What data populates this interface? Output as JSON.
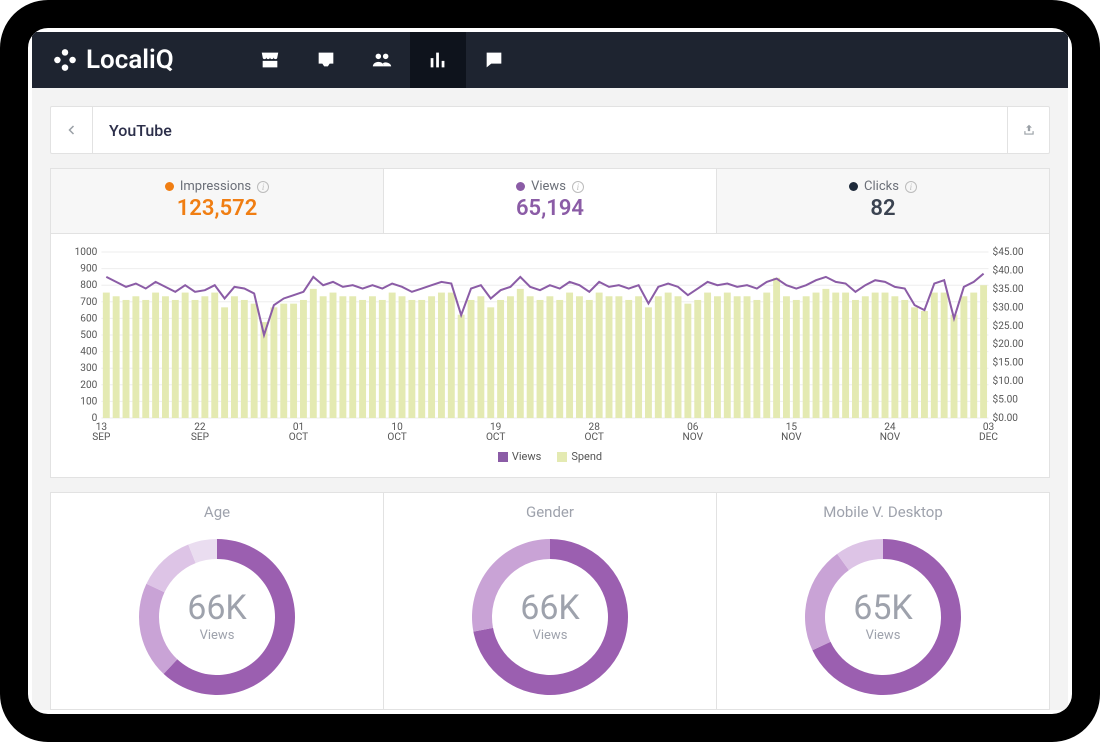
{
  "brand": {
    "name": "LocaliQ"
  },
  "nav": {
    "items": [
      "store",
      "inbox",
      "people",
      "analytics",
      "chat"
    ],
    "active": "analytics"
  },
  "page": {
    "title": "YouTube"
  },
  "metrics": [
    {
      "key": "impressions",
      "label": "Impressions",
      "value": "123,572",
      "color": "#f07e13",
      "valueColor": "#f07e13"
    },
    {
      "key": "views",
      "label": "Views",
      "value": "65,194",
      "color": "#8b5ca6",
      "valueColor": "#8b5ca6",
      "active": true
    },
    {
      "key": "clicks",
      "label": "Clicks",
      "value": "82",
      "color": "#1e2a3a",
      "valueColor": "#3b4351"
    }
  ],
  "chart_data": {
    "type": "bar+line",
    "title": "",
    "xlabel": "",
    "ylabel_left": "Views",
    "ylabel_right": "Spend",
    "ylim_left": [
      0,
      1000
    ],
    "ylim_right": [
      0,
      45
    ],
    "y_ticks_left": [
      0,
      100,
      200,
      300,
      400,
      500,
      600,
      700,
      800,
      900,
      1000
    ],
    "y_ticks_right": [
      "$0.00",
      "$5.00",
      "$10.00",
      "$15.00",
      "$20.00",
      "$25.00",
      "$30.00",
      "$35.00",
      "$40.00",
      "$45.00"
    ],
    "x_ticks": [
      "13 SEP",
      "22 SEP",
      "01 OCT",
      "10 OCT",
      "19 OCT",
      "28 OCT",
      "06 NOV",
      "15 NOV",
      "24 NOV",
      "03 DEC"
    ],
    "legend": [
      {
        "name": "Views",
        "color": "#8b5ca6"
      },
      {
        "name": "Spend",
        "color": "#e4eab2"
      }
    ],
    "series": [
      {
        "name": "Views",
        "type": "line",
        "color": "#8b5ca6",
        "values": [
          850,
          820,
          790,
          810,
          780,
          820,
          790,
          760,
          800,
          760,
          770,
          800,
          720,
          790,
          780,
          750,
          500,
          680,
          720,
          740,
          760,
          850,
          800,
          820,
          790,
          800,
          780,
          800,
          780,
          810,
          790,
          760,
          780,
          800,
          820,
          810,
          620,
          780,
          800,
          720,
          770,
          790,
          850,
          790,
          770,
          800,
          780,
          820,
          800,
          760,
          820,
          790,
          800,
          780,
          800,
          690,
          790,
          810,
          790,
          740,
          780,
          820,
          800,
          810,
          790,
          800,
          780,
          820,
          840,
          800,
          780,
          800,
          830,
          850,
          820,
          810,
          760,
          800,
          830,
          820,
          790,
          780,
          680,
          650,
          810,
          830,
          600,
          790,
          820,
          870
        ]
      },
      {
        "name": "Spend",
        "type": "bar",
        "color": "#e4eab2",
        "axis": "right",
        "values": [
          34,
          33,
          32,
          33,
          32,
          34,
          33,
          32,
          34,
          32,
          33,
          34,
          30,
          33,
          32,
          31,
          26,
          30,
          31,
          31,
          32,
          35,
          33,
          34,
          33,
          33,
          32,
          33,
          32,
          34,
          33,
          32,
          32,
          33,
          34,
          34,
          28,
          32,
          33,
          30,
          32,
          33,
          35,
          33,
          32,
          33,
          32,
          34,
          33,
          32,
          34,
          33,
          33,
          32,
          33,
          30,
          33,
          34,
          33,
          31,
          32,
          34,
          33,
          34,
          33,
          33,
          32,
          34,
          38,
          33,
          32,
          33,
          34,
          35,
          34,
          34,
          32,
          33,
          34,
          34,
          33,
          32,
          30,
          29,
          34,
          34,
          28,
          33,
          34,
          36
        ]
      }
    ]
  },
  "donuts": [
    {
      "title": "Age",
      "center_value": "66K",
      "center_label": "Views",
      "unit": "K",
      "segments": [
        {
          "color": "#9b5fb0",
          "value": 62
        },
        {
          "color": "#c9a3d6",
          "value": 20
        },
        {
          "color": "#ddc4e6",
          "value": 12
        },
        {
          "color": "#eaddf0",
          "value": 6
        }
      ]
    },
    {
      "title": "Gender",
      "center_value": "66K",
      "center_label": "Views",
      "unit": "K",
      "segments": [
        {
          "color": "#9b5fb0",
          "value": 72
        },
        {
          "color": "#c9a3d6",
          "value": 28
        }
      ]
    },
    {
      "title": "Mobile V. Desktop",
      "center_value": "65K",
      "center_label": "Views",
      "unit": "K",
      "segments": [
        {
          "color": "#9b5fb0",
          "value": 68
        },
        {
          "color": "#c9a3d6",
          "value": 22
        },
        {
          "color": "#ddc4e6",
          "value": 10
        }
      ]
    }
  ]
}
